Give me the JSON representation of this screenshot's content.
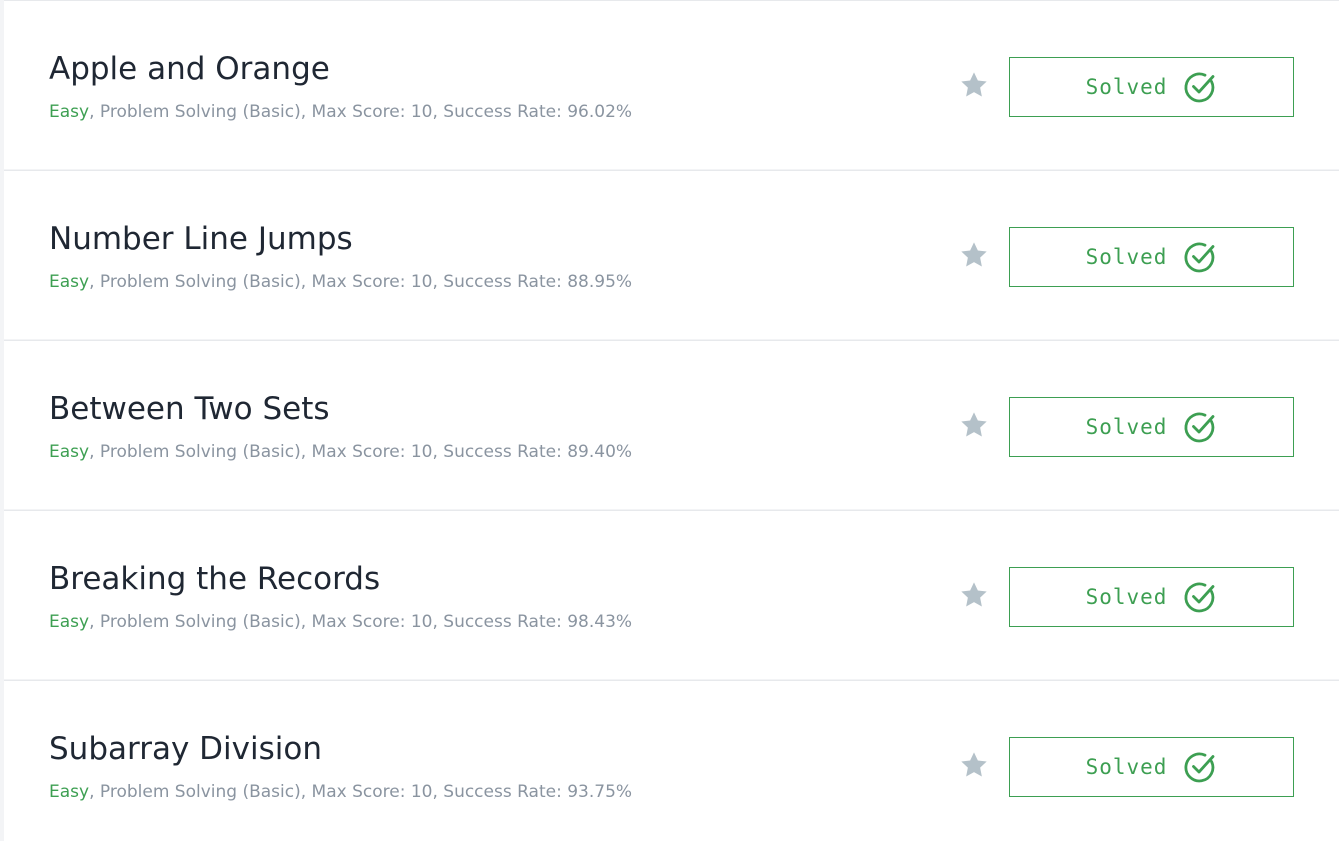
{
  "challenges": [
    {
      "title": "Apple and Orange",
      "difficulty": "Easy",
      "details": ", Problem Solving (Basic), Max Score: 10, Success Rate: 96.02%",
      "status_label": "Solved"
    },
    {
      "title": "Number Line Jumps",
      "difficulty": "Easy",
      "details": ", Problem Solving (Basic), Max Score: 10, Success Rate: 88.95%",
      "status_label": "Solved"
    },
    {
      "title": "Between Two Sets",
      "difficulty": "Easy",
      "details": ", Problem Solving (Basic), Max Score: 10, Success Rate: 89.40%",
      "status_label": "Solved"
    },
    {
      "title": "Breaking the Records",
      "difficulty": "Easy",
      "details": ", Problem Solving (Basic), Max Score: 10, Success Rate: 98.43%",
      "status_label": "Solved"
    },
    {
      "title": "Subarray Division",
      "difficulty": "Easy",
      "details": ", Problem Solving (Basic), Max Score: 10, Success Rate: 93.75%",
      "status_label": "Solved"
    }
  ],
  "colors": {
    "accent_green": "#3d9f52",
    "star_gray": "#b4c1c9",
    "title_text": "#1f2733",
    "meta_text": "#8a94a0"
  },
  "icons": {
    "bookmark": "star-icon",
    "solved": "check-circle-icon"
  }
}
